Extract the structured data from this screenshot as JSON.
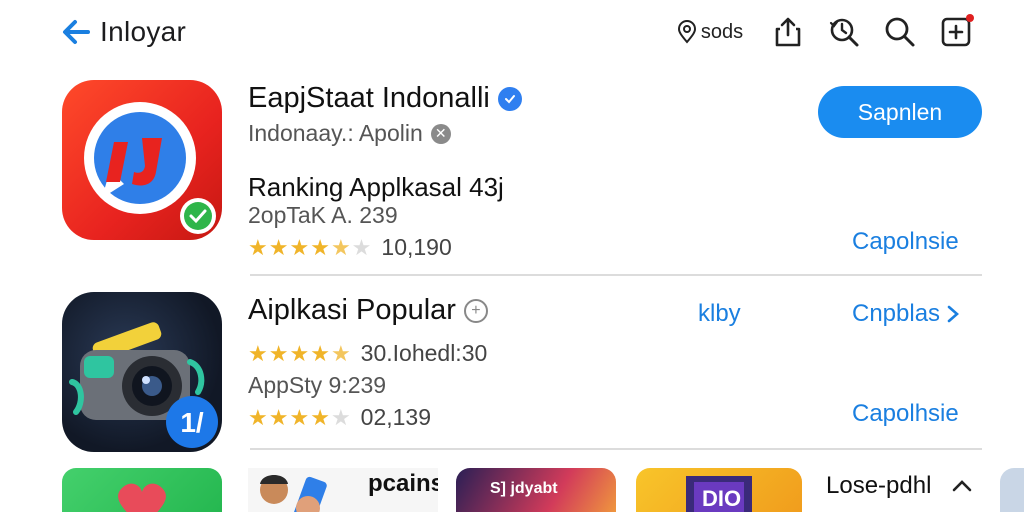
{
  "topbar": {
    "back_label": "Inloyar",
    "location_text": "sods"
  },
  "apps": [
    {
      "title": "EapjStaat Indonalli",
      "subtitle": "Indonaay.: Apolin",
      "section": "Ranking Applkasal 43j",
      "meta": "2opTaK A. 239",
      "rating_stars": 4.5,
      "rating_count": "10,190",
      "get_label": "Sapnlen",
      "link_label": "Capolnsie"
    },
    {
      "title": "Aiplkasi Popular",
      "rating1_text": "30.Iohedl:30",
      "rating1_stars": 4.5,
      "meta": "AppSty 9:239",
      "rating2_stars": 4,
      "rating2_count": "02,139",
      "middle_link": "klby",
      "link_label": "Cnpblas",
      "link2_label": "Capolhsie"
    }
  ],
  "strip": {
    "tile2_text": "pcainst",
    "tile3_text": "S] jdyabt",
    "tile4_text": "DIO",
    "more_label": "Lose-pdhl"
  },
  "colors": {
    "accent": "#1a8cf0",
    "link": "#1a7fe0",
    "star": "#f0b429"
  }
}
